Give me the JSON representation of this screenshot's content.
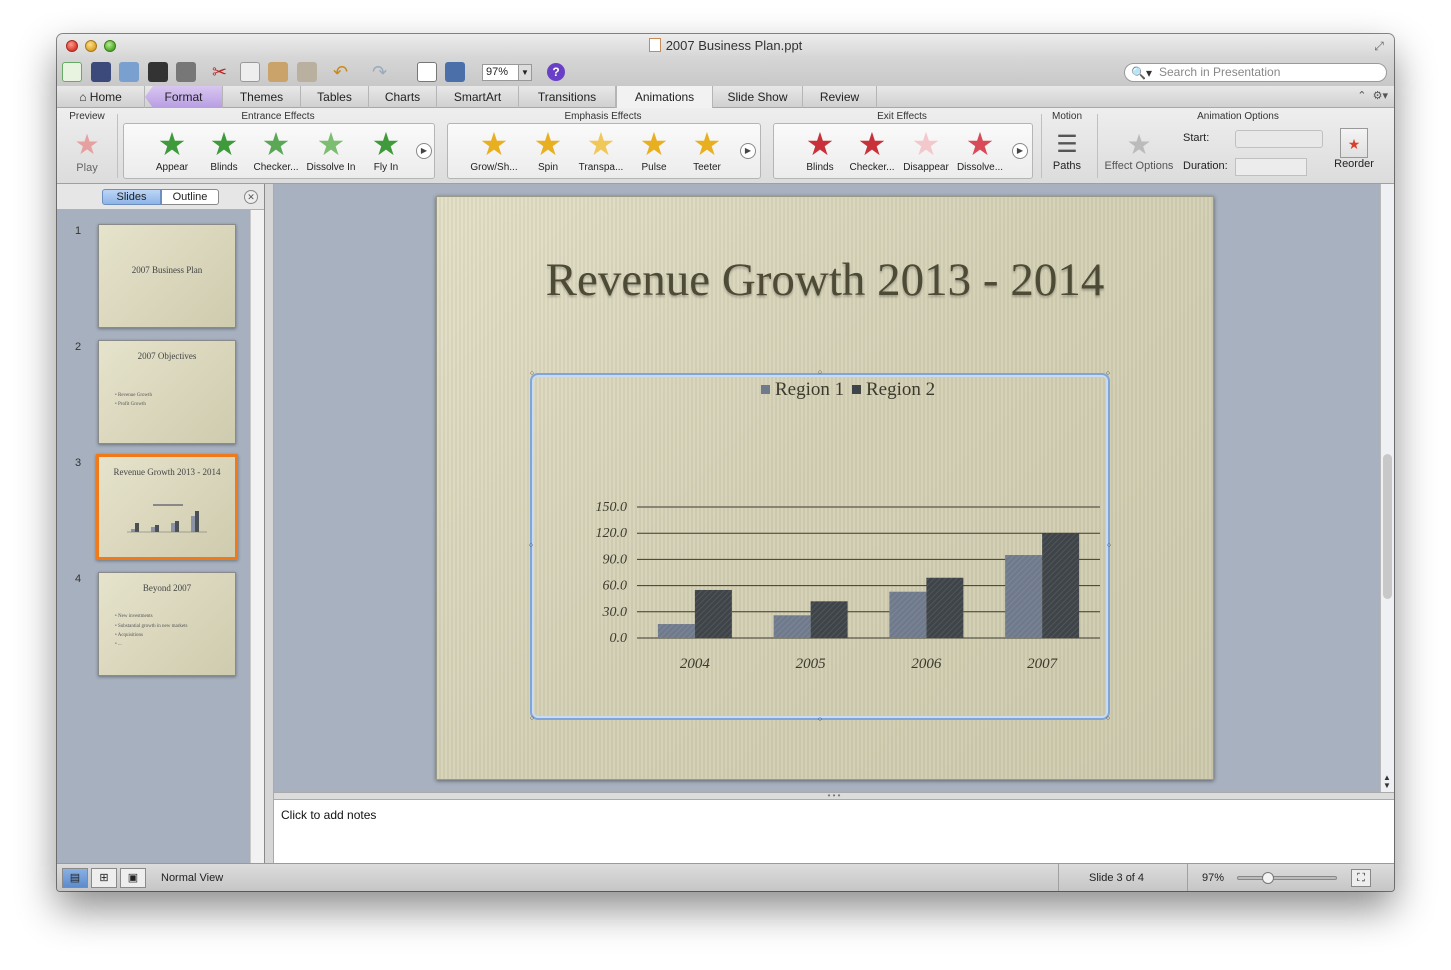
{
  "window": {
    "title": "2007 Business Plan.ppt"
  },
  "toolbar": {
    "zoom": "97%",
    "search_placeholder": "Search in Presentation"
  },
  "tabs": [
    {
      "label": "Home"
    },
    {
      "label": "Format"
    },
    {
      "label": "Themes"
    },
    {
      "label": "Tables"
    },
    {
      "label": "Charts"
    },
    {
      "label": "SmartArt"
    },
    {
      "label": "Transitions"
    },
    {
      "label": "Animations"
    },
    {
      "label": "Slide Show"
    },
    {
      "label": "Review"
    }
  ],
  "ribbon": {
    "preview": {
      "title": "Preview",
      "play": "Play"
    },
    "entrance": {
      "title": "Entrance Effects",
      "items": [
        "Appear",
        "Blinds",
        "Checker...",
        "Dissolve In",
        "Fly In"
      ]
    },
    "emphasis": {
      "title": "Emphasis Effects",
      "items": [
        "Grow/Sh...",
        "Spin",
        "Transpa...",
        "Pulse",
        "Teeter"
      ]
    },
    "exit": {
      "title": "Exit Effects",
      "items": [
        "Blinds",
        "Checker...",
        "Disappear",
        "Dissolve..."
      ]
    },
    "motion": {
      "title": "Motion",
      "paths": "Paths"
    },
    "options": {
      "title": "Animation Options",
      "effect_options": "Effect Options",
      "start": "Start:",
      "duration": "Duration:",
      "reorder": "Reorder"
    }
  },
  "sidebar": {
    "tab_slides": "Slides",
    "tab_outline": "Outline",
    "thumbs": [
      {
        "num": "1",
        "title": "2007 Business Plan",
        "bullets": []
      },
      {
        "num": "2",
        "title": "2007 Objectives",
        "bullets": [
          "• Revenue Growth",
          "• Profit Growth"
        ]
      },
      {
        "num": "3",
        "title": "Revenue Growth 2013 - 2014",
        "bullets": []
      },
      {
        "num": "4",
        "title": "Beyond 2007",
        "bullets": [
          "• New investments",
          "• Substantial growth in new markets",
          "• Acquisitions",
          "• ..."
        ]
      }
    ]
  },
  "slide": {
    "title": "Revenue Growth 2013 - 2014"
  },
  "chart_data": {
    "type": "bar",
    "categories": [
      "2004",
      "2005",
      "2006",
      "2007"
    ],
    "series": [
      {
        "name": "Region 1",
        "values": [
          16,
          26,
          53,
          95
        ]
      },
      {
        "name": "Region 2",
        "values": [
          55,
          42,
          69,
          120
        ]
      }
    ],
    "yticks": [
      "0.0",
      "30.0",
      "60.0",
      "90.0",
      "120.0",
      "150.0"
    ],
    "ylim": [
      0,
      150
    ],
    "legend": "top",
    "colors": {
      "Region 1": "#6f7a8c",
      "Region 2": "#3e4448"
    }
  },
  "notes": {
    "placeholder": "Click to add notes"
  },
  "status": {
    "view": "Normal View",
    "slide": "Slide 3 of 4",
    "zoom": "97%",
    "zoom_level": 0.27
  }
}
